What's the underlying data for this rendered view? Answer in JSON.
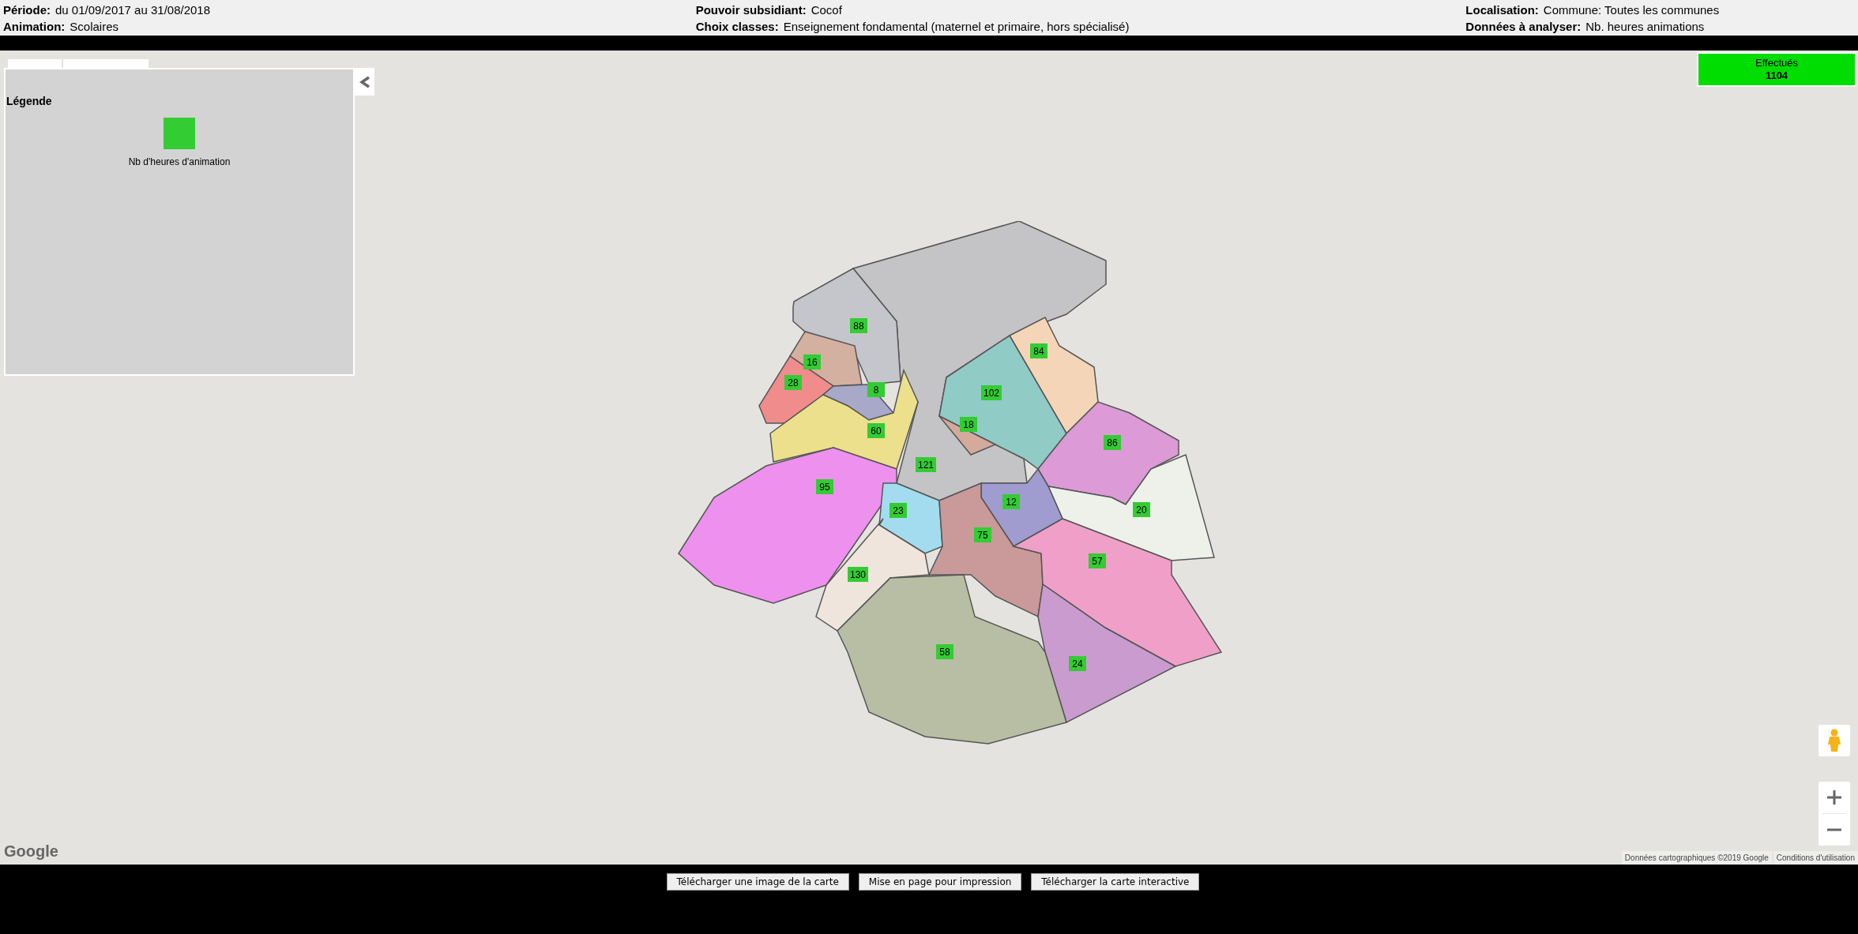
{
  "header": [
    {
      "label": "Période:",
      "value": "du 01/09/2017 au 31/08/2018"
    },
    {
      "label": "Pouvoir subsidiant:",
      "value": "Cocof"
    },
    {
      "label": "Localisation:",
      "value": "Commune: Toutes les communes"
    },
    {
      "label": "Animation:",
      "value": "Scolaires"
    },
    {
      "label": "Choix classes:",
      "value": "Enseignement fondamental (maternel et primaire, hors spécialisé)"
    },
    {
      "label": "Données à analyser:",
      "value": "Nb. heures animations"
    }
  ],
  "legend": {
    "title": "Légende",
    "items": [
      {
        "label": "Nb d'heures d'animation",
        "color": "#33cc33"
      }
    ]
  },
  "total": {
    "label": "Effectués",
    "value": "1104"
  },
  "communes": [
    {
      "value": "121",
      "color": "#c4c4c6"
    },
    {
      "value": "88",
      "color": "#c5c6cc"
    },
    {
      "value": "16",
      "color": "#d4b0a0"
    },
    {
      "value": "28",
      "color": "#f08c8c"
    },
    {
      "value": "8",
      "color": "#a8a8c8"
    },
    {
      "value": "60",
      "color": "#ece08c"
    },
    {
      "value": "95",
      "color": "#ee90ee"
    },
    {
      "value": "84",
      "color": "#f5d5b8"
    },
    {
      "value": "102",
      "color": "#90cbc5"
    },
    {
      "value": "18",
      "color": "#d4aa9c"
    },
    {
      "value": "86",
      "color": "#dc9ad6"
    },
    {
      "value": "20",
      "color": "#eef0ea"
    },
    {
      "value": "12",
      "color": "#a09ccf"
    },
    {
      "value": "23",
      "color": "#a4dcef"
    },
    {
      "value": "75",
      "color": "#c99a99"
    },
    {
      "value": "57",
      "color": "#f0a0c8"
    },
    {
      "value": "24",
      "color": "#c99bcf"
    },
    {
      "value": "130",
      "color": "#efe5dd"
    },
    {
      "value": "58",
      "color": "#b7bea4"
    }
  ],
  "map_footer": {
    "logo": "Google",
    "attribution": "Données cartographiques ©2019 Google",
    "terms": "Conditions d'utilisation"
  },
  "buttons": [
    "Télécharger une image de la carte",
    "Mise en page pour impression",
    "Télécharger la carte interactive"
  ]
}
